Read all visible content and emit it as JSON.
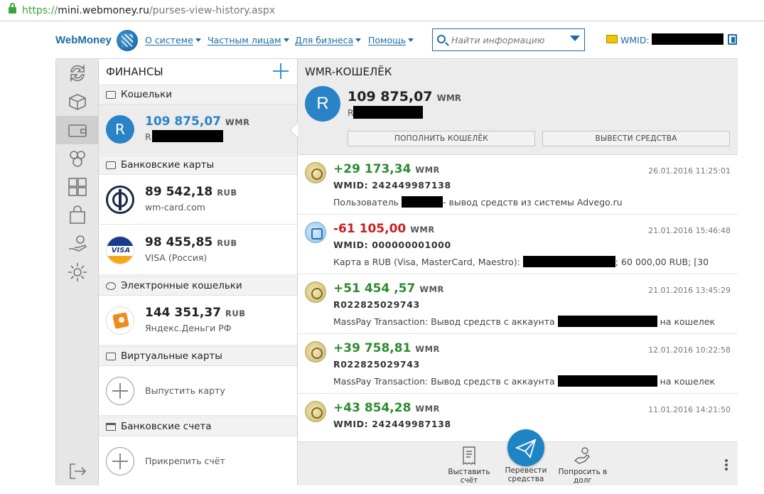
{
  "browser": {
    "protocol": "https://",
    "host": "mini.webmoney.ru",
    "path": "/purses-view-history.aspx"
  },
  "header": {
    "logo": "WebMoney",
    "nav": [
      "О системе",
      "Частным лицам",
      "Для бизнеса",
      "Помощь"
    ],
    "search_placeholder": "Найти информацию",
    "wmid_label": "WMID:"
  },
  "finances": {
    "title": "ФИНАНСЫ",
    "sections": {
      "wallets": "Кошельки",
      "bank_cards": "Банковские карты",
      "e_wallets": "Электронные кошельки",
      "virtual_cards": "Виртуальные карты",
      "bank_accounts": "Банковские счета"
    },
    "wallet": {
      "amount": "109 875,07",
      "currency": "WMR",
      "prefix": "R",
      "avatar": "R"
    },
    "cards": [
      {
        "amount": "89 542,18",
        "currency": "RUB",
        "name": "wm-card.com"
      },
      {
        "amount": "98 455,85",
        "currency": "RUB",
        "name": "VISA (Россия)",
        "logo": "VISA"
      }
    ],
    "ewallet": {
      "amount": "144 351,37",
      "currency": "RUB",
      "name": "Яндекс.Деньги РФ"
    },
    "issue_card": "Выпустить карту",
    "attach_account": "Прикрепить счёт"
  },
  "purse": {
    "title": "WMR-КОШЕЛЁК",
    "avatar": "R",
    "amount": "109 875,07",
    "currency": "WMR",
    "prefix": "R",
    "topup_btn": "ПОПОЛНИТЬ КОШЕЛЁК",
    "withdraw_btn": "ВЫВЕСТИ СРЕДСТВА"
  },
  "transactions": [
    {
      "amount": "+29 173,34",
      "currency": "WMR",
      "date": "26.01.2016 11:25:01",
      "wmid": "WMID: 242449987138",
      "desc_a": "Пользователь",
      "desc_b": "- вывод средств из системы Advego.ru"
    },
    {
      "amount": "-61 105,00",
      "currency": "WMR",
      "date": "21.01.2016 15:46:48",
      "wmid": "WMID: 000000001000",
      "desc_a": "Карта в RUB (Visa, MasterCard, Maestro):",
      "desc_b": "; 60 000,00 RUB; [30"
    },
    {
      "amount": "+51 454 ,57",
      "currency": "WMR",
      "date": "21.01.2016 13:45:29",
      "wmid": "R022825029743",
      "desc_a": "MassPay Transaction: Вывод средств с аккаунта",
      "desc_b": "на кошелек"
    },
    {
      "amount": "+39 758,81",
      "currency": "WMR",
      "date": "12.01.2016 10:22:58",
      "wmid": "R022825029743",
      "desc_a": "MassPay Transaction: Вывод средств с аккаунта",
      "desc_b": "на кошелек"
    },
    {
      "amount": "+43 854,28",
      "currency": "WMR",
      "date": "11.01.2016 14:21:50",
      "wmid": "WMID: 242449987138",
      "desc_a": "",
      "desc_b": ""
    }
  ],
  "actions": {
    "invoice": [
      "Выставить",
      "счёт"
    ],
    "transfer": [
      "Перевести",
      "средства"
    ],
    "loan": [
      "Попросить в",
      "долг"
    ]
  },
  "icons": {
    "sidebar": [
      "refresh-icon",
      "package-icon",
      "wallet-icon",
      "contacts-icon",
      "services-icon",
      "shop-bag-icon",
      "hand-coin-icon",
      "settings-gear-icon",
      "logout-icon"
    ]
  },
  "colors": {
    "accent": "#1f84c4",
    "positive": "#2e8b2e",
    "negative": "#cc1f1f"
  }
}
